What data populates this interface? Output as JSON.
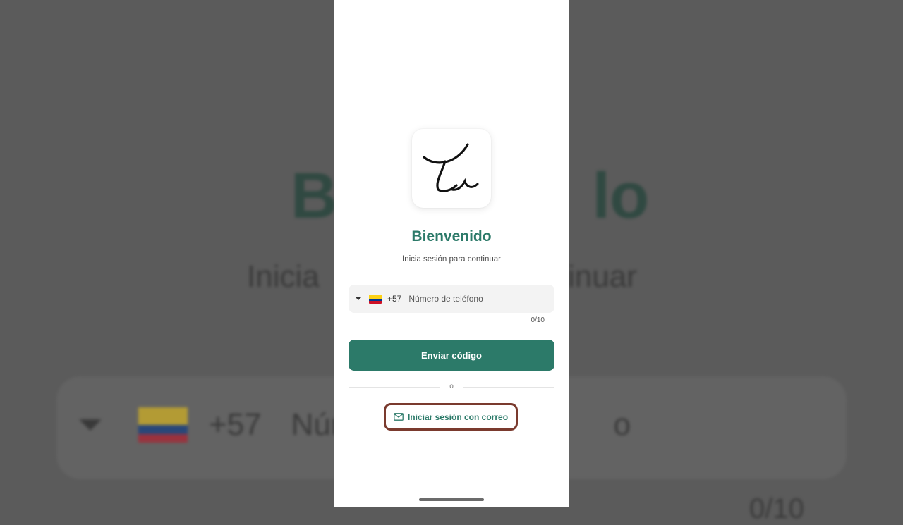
{
  "background": {
    "title_fragment_1": "B",
    "title_fragment_2": "lo",
    "subtitle_fragment_1": "Inicia",
    "subtitle_fragment_2": "tinuar",
    "country_code": "+57",
    "placeholder_fragment_1": "Núm",
    "placeholder_fragment_2": "o",
    "counter": "0/10"
  },
  "login": {
    "title": "Bienvenido",
    "subtitle": "Inicia sesión para continuar",
    "phone_field": {
      "country_flag": "colombia-flag",
      "country_code": "+57",
      "placeholder": "Número de teléfono",
      "value": "",
      "counter": "0/10"
    },
    "send_button_label": "Enviar código",
    "divider_label": "o",
    "email_button_label": "Iniciar sesión con correo"
  },
  "icons": {
    "logo": "handwritten-logo",
    "email": "mail-icon",
    "dropdown": "dropdown-arrow-icon"
  },
  "colors": {
    "accent": "#2c7a69",
    "highlight_border": "#7a3a2e",
    "flag_yellow": "#fcd116",
    "flag_blue": "#003893",
    "flag_red": "#ce1126"
  }
}
